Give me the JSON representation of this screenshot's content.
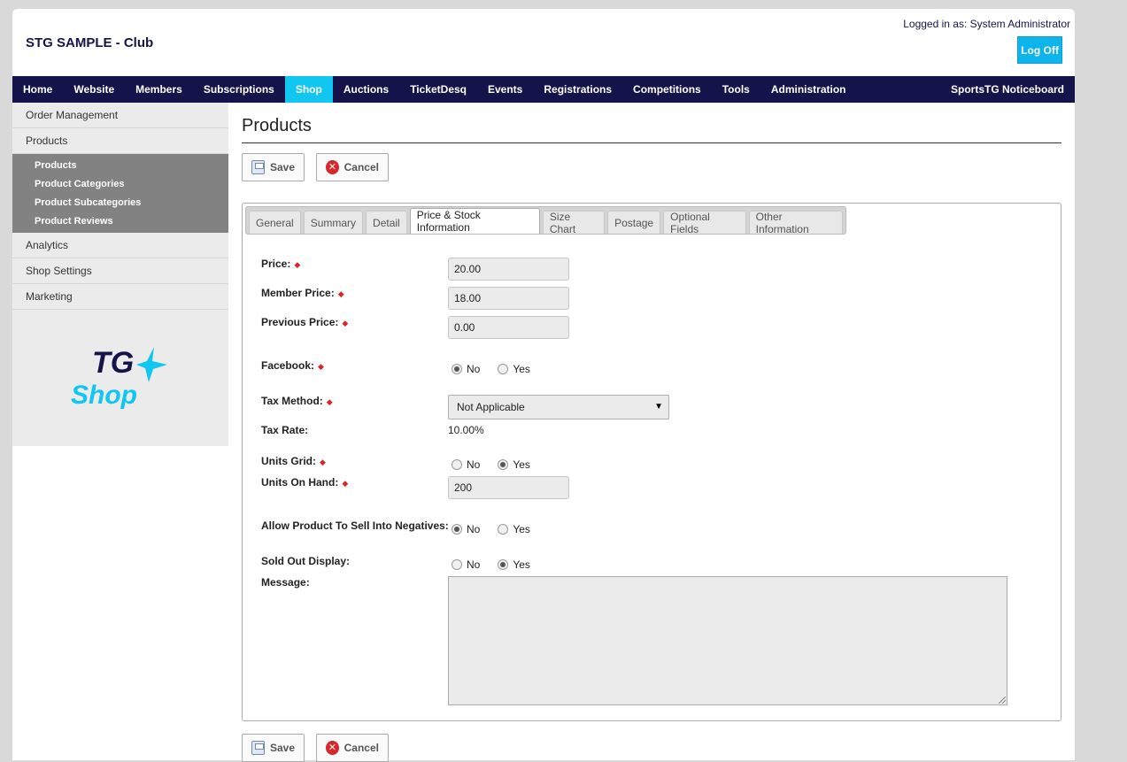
{
  "header": {
    "club_name": "STG SAMPLE - Club",
    "logged_in": "Logged in as: System Administrator",
    "logoff": "Log Off"
  },
  "nav": {
    "items": [
      "Home",
      "Website",
      "Members",
      "Subscriptions",
      "Shop",
      "Auctions",
      "TicketDesq",
      "Events",
      "Registrations",
      "Competitions",
      "Tools",
      "Administration"
    ],
    "active": "Shop",
    "right": "SportsTG Noticeboard"
  },
  "sidebar": {
    "order_management": "Order Management",
    "products": "Products",
    "sub": [
      "Products",
      "Product Categories",
      "Product Subcategories",
      "Product Reviews"
    ],
    "analytics": "Analytics",
    "shop_settings": "Shop Settings",
    "marketing": "Marketing",
    "logo_tg": "TG",
    "logo_shop": "Shop"
  },
  "main": {
    "title": "Products",
    "save": "Save",
    "cancel": "Cancel",
    "tabs": [
      "General",
      "Summary",
      "Detail",
      "Price & Stock Information",
      "Size Chart",
      "Postage",
      "Optional Fields",
      "Other Information"
    ],
    "active_tab": "Price & Stock Information"
  },
  "form": {
    "price_label": "Price:",
    "price": "20.00",
    "member_price_label": "Member Price:",
    "member_price": "18.00",
    "previous_price_label": "Previous Price:",
    "previous_price": "0.00",
    "facebook_label": "Facebook:",
    "facebook_value": "No",
    "tax_method_label": "Tax Method:",
    "tax_method": "Not Applicable",
    "tax_rate_label": "Tax Rate:",
    "tax_rate": "10.00%",
    "units_grid_label": "Units Grid:",
    "units_grid_value": "Yes",
    "units_on_hand_label": "Units On Hand:",
    "units_on_hand": "200",
    "negatives_label": "Allow Product To Sell Into Negatives:",
    "negatives_value": "No",
    "sold_out_label": "Sold Out Display:",
    "sold_out_value": "Yes",
    "message_label": "Message:",
    "no": "No",
    "yes": "Yes"
  },
  "colors": {
    "nav_bg": "#15144a",
    "nav_active": "#11c6f0",
    "logoff_bg": "#0eb4ec",
    "required": "#d9262b"
  }
}
